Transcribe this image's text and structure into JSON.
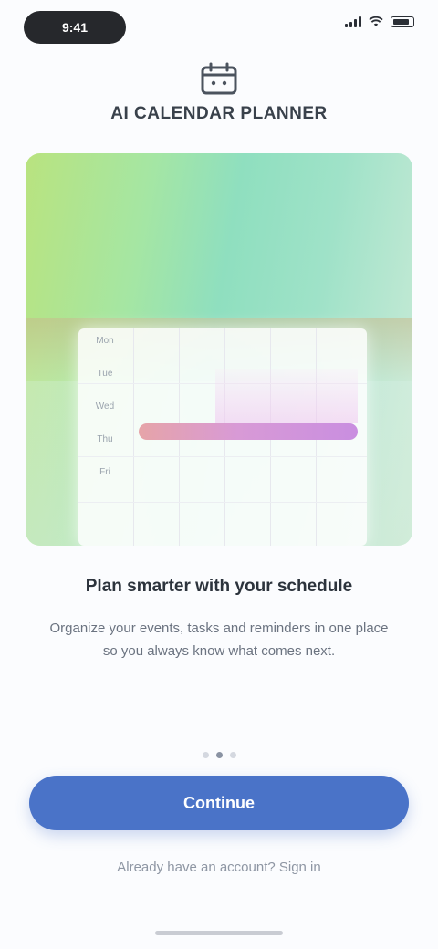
{
  "status_bar": {
    "time": "9:41"
  },
  "app": {
    "title": "AI CALENDAR PLANNER"
  },
  "hero": {
    "day_labels": [
      "Mon",
      "Tue",
      "Wed",
      "Thu",
      "Fri"
    ]
  },
  "onboarding": {
    "headline": "Plan smarter with your schedule",
    "body": "Organize your events, tasks and reminders in one place so you always know what comes next.",
    "total_pages": 3,
    "current_page": 2
  },
  "actions": {
    "primary_label": "Continue",
    "secondary_label": "Already have an account? Sign in"
  },
  "colors": {
    "primary_button": "#4a73c8",
    "event_gradient_start": "#e6a4a8",
    "event_gradient_end": "#c98ee0"
  }
}
